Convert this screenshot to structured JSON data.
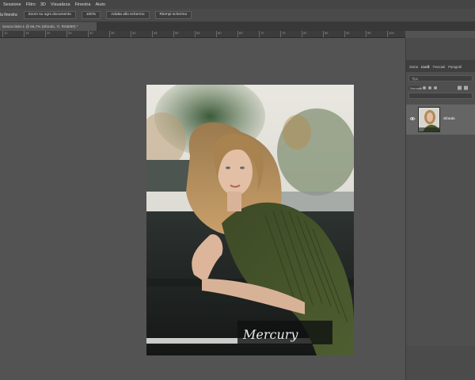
{
  "menubar": {
    "items": [
      "Sessione",
      "Filtro",
      "3D",
      "Visualizza",
      "Finestra",
      "Aiuto"
    ]
  },
  "options": {
    "resize_windows_label": "la finestra",
    "zoom_all_label": "Zoom su ogni documento",
    "zoom_value": "100%",
    "fit_screen_label": "Adatta allo schermo",
    "fill_screen_label": "Riempi schermo"
  },
  "document": {
    "tab_label": "Senza titolo-1 @ 66,7% (Sfondo, 7/, RGB/8#) *"
  },
  "ruler": {
    "labels": [
      "10",
      "15",
      "20",
      "25",
      "30",
      "35",
      "40",
      "45",
      "50",
      "55",
      "60",
      "65",
      "70",
      "75",
      "80",
      "85",
      "90",
      "95",
      "100"
    ]
  },
  "photo": {
    "car_badge_text": "Mercury"
  },
  "panel": {
    "tabs": [
      "Storia",
      "Livelli",
      "Tracciati",
      "Paragrafi"
    ],
    "active_tab": "Livelli",
    "search_placeholder": "Tipo",
    "blend_mode": "Normale",
    "layer_name": "Sfondo"
  },
  "colors": {
    "app_bg": "#535353",
    "panel_bg": "#4f4f4f",
    "selected_layer": "#656565"
  }
}
